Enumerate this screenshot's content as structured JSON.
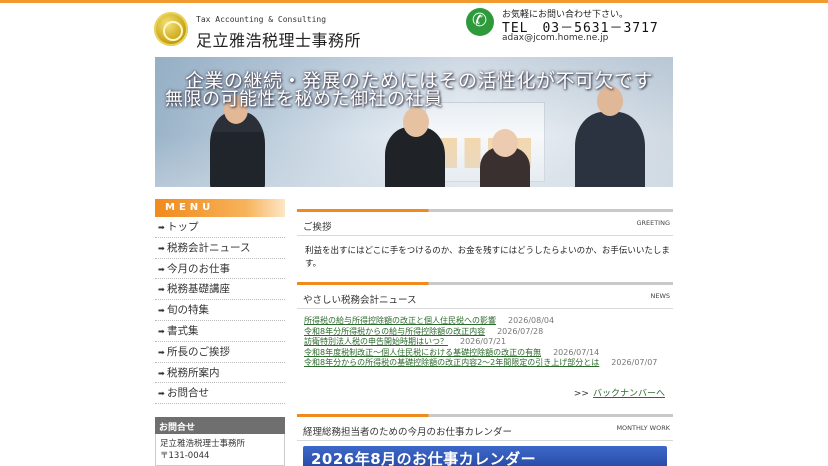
{
  "header": {
    "logo_sub": "Tax Accounting & Consulting",
    "logo_main": "足立雅浩税理士事務所",
    "tel_note": "お気軽にお問い合わせ下さい。",
    "tel_number": "TEL　03－5631－3717",
    "email": "adax@jcom.home.ne.jp"
  },
  "hero": {
    "line1": "企業の継続・発展のためにはその活性化が不可欠です",
    "line2": "無限の可能性を秘めた御社の社員"
  },
  "menu": {
    "title": "MENU",
    "items": [
      {
        "label": "トップ"
      },
      {
        "label": "税務会計ニュース"
      },
      {
        "label": "今月のお仕事"
      },
      {
        "label": "税務基礎講座"
      },
      {
        "label": "旬の特集"
      },
      {
        "label": "書式集"
      },
      {
        "label": "所長のご挨拶"
      },
      {
        "label": "税務所案内"
      },
      {
        "label": "お問合せ"
      }
    ]
  },
  "contact": {
    "title": "お問合せ",
    "name": "足立雅浩税理士事務所",
    "postal": "〒131-0044"
  },
  "greeting": {
    "title": "ご挨拶",
    "en": "GREETING",
    "text": "利益を出すにはどこに手をつけるのか、お金を残すにはどうしたらよいのか、お手伝いいたします。"
  },
  "news": {
    "title": "やさしい税務会計ニュース",
    "en": "NEWS",
    "items": [
      {
        "title": "所得税の給与所得控除額の改正と個人住民税への影響",
        "date": "2026/08/04"
      },
      {
        "title": "令和8年分所得税からの給与所得控除額の改正内容",
        "date": "2026/07/28"
      },
      {
        "title": "訪衛特別法人税の申告開始時期はいつ？",
        "date": "2026/07/21"
      },
      {
        "title": "令和8年度税制改正～個人住民税における基礎控除額の改正の有無",
        "date": "2026/07/14"
      },
      {
        "title": "令和8年分からの所得税の基礎控除額の改正内容2～2年間限定の引き上げ部分とは",
        "date": "2026/07/07"
      }
    ],
    "back_prefix": ">>",
    "back_label": "バックナンバーへ"
  },
  "calendar": {
    "title": "経理総務担当者のための今月のお仕事カレンダー",
    "en": "MONTHLY WORK",
    "banner": "2026年8月のお仕事カレンダー"
  },
  "colors": {
    "accent": "#f08a1c",
    "link": "#2d6a2d",
    "banner": "#2a4ea8"
  }
}
